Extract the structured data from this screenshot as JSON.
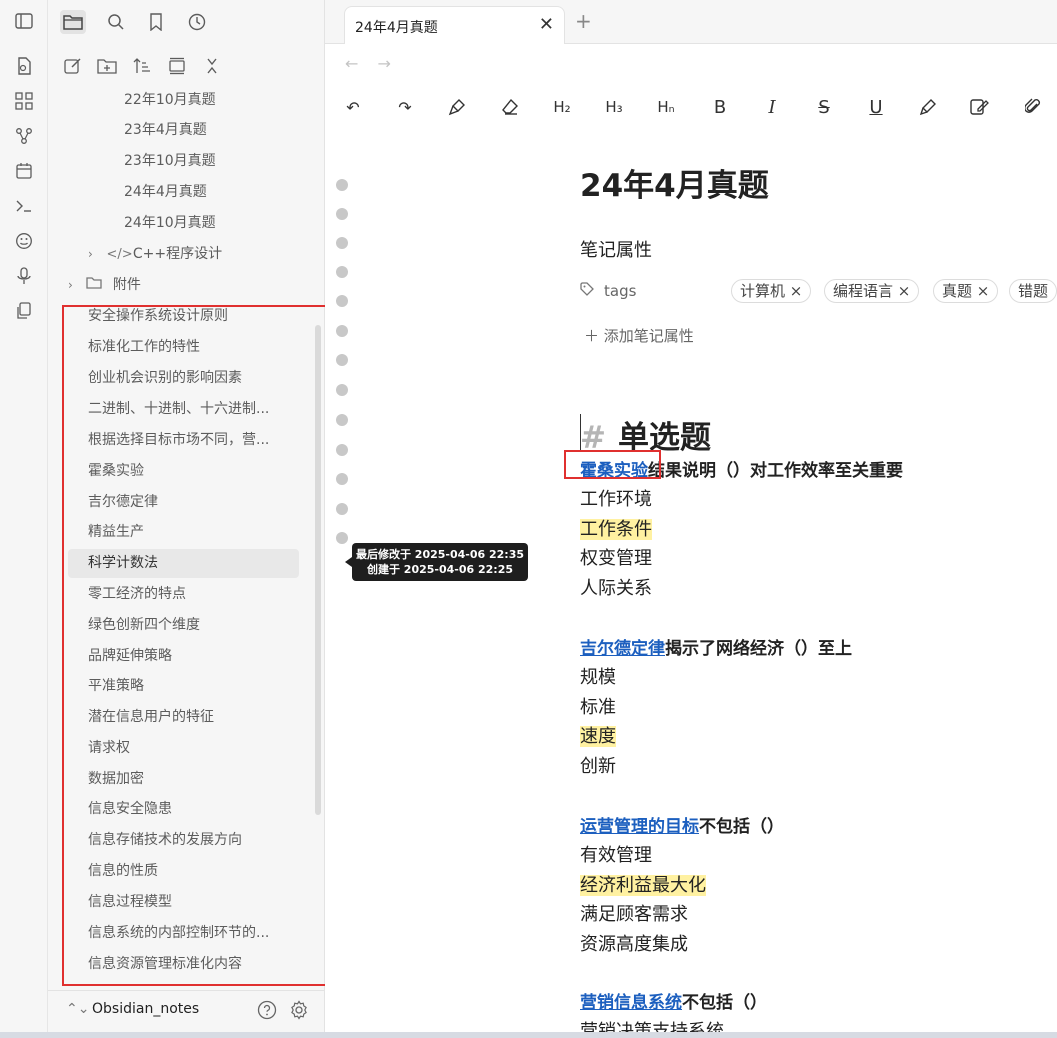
{
  "ribbon": {
    "icons": [
      "sidebar-toggle-icon",
      "new-note-icon",
      "canvas-icon",
      "graph-icon",
      "calendar-icon",
      "terminal-icon",
      "smiley-icon",
      "microphone-icon",
      "copy-icon"
    ]
  },
  "sidebar_top": {
    "icons": [
      "folder-icon",
      "search-icon",
      "bookmark-icon",
      "clock-icon"
    ]
  },
  "sidebar_actions": {
    "icons": [
      "new-note-icon",
      "new-folder-icon",
      "sort-icon",
      "collapse-icon",
      "close-icon"
    ]
  },
  "tree": {
    "items": [
      {
        "label": "22年10月真题"
      },
      {
        "label": "23年4月真题"
      },
      {
        "label": "23年10月真题"
      },
      {
        "label": "24年4月真题"
      },
      {
        "label": "24年10月真题"
      },
      {
        "label": "C++程序设计"
      },
      {
        "label": "附件"
      }
    ]
  },
  "files": {
    "items": [
      {
        "label": "安全操作系统设计原则"
      },
      {
        "label": "标准化工作的特性"
      },
      {
        "label": "创业机会识别的影响因素"
      },
      {
        "label": "二进制、十进制、十六进制..."
      },
      {
        "label": "根据选择目标市场不同，营..."
      },
      {
        "label": "霍桑实验"
      },
      {
        "label": "吉尔德定律"
      },
      {
        "label": "精益生产"
      },
      {
        "label": "科学计数法"
      },
      {
        "label": "零工经济的特点"
      },
      {
        "label": "绿色创新四个维度"
      },
      {
        "label": "品牌延伸策略"
      },
      {
        "label": "平准策略"
      },
      {
        "label": "潜在信息用户的特征"
      },
      {
        "label": "请求权"
      },
      {
        "label": "数据加密"
      },
      {
        "label": "信息安全隐患"
      },
      {
        "label": "信息存储技术的发展方向"
      },
      {
        "label": "信息的性质"
      },
      {
        "label": "信息过程模型"
      },
      {
        "label": "信息系统的内部控制环节的..."
      },
      {
        "label": "信息资源管理标准化内容"
      }
    ],
    "active_index": 8
  },
  "vault": {
    "name": "Obsidian_notes",
    "swap": "⌃⌄"
  },
  "tabs": {
    "active": "24年4月真题",
    "close": "✕",
    "new": "+"
  },
  "nav": {
    "back": "←",
    "forward": "→"
  },
  "toolbar": {
    "undo": "↶",
    "redo": "↷",
    "h2": "H₂",
    "h3": "H₃",
    "hn": "Hₙ",
    "bold": "B",
    "italic": "I",
    "strike": "S",
    "underline": "U"
  },
  "tooltip": {
    "modified": "最后修改于 2025-04-06 22:35",
    "created": "创建于 2025-04-06 22:25"
  },
  "doc": {
    "title": "24年4月真题",
    "props_title": "笔记属性",
    "tags_key": "tags",
    "tags": [
      "计算机 ×",
      "编程语言 ×",
      "真题 ×",
      "错题"
    ],
    "add_property": "＋ 添加笔记属性",
    "heading_hash": "#",
    "heading": "单选题",
    "questions": [
      {
        "link": "霍桑实验",
        "rest": "结果说明（）对工作效率至关重要",
        "options": [
          {
            "text": "工作环境",
            "highlight": false
          },
          {
            "text": "工作条件",
            "highlight": true
          },
          {
            "text": "权变管理",
            "highlight": false
          },
          {
            "text": "人际关系",
            "highlight": false
          }
        ]
      },
      {
        "link": "吉尔德定律",
        "rest": "揭示了网络经济（）至上",
        "options": [
          {
            "text": "规模",
            "highlight": false
          },
          {
            "text": "标准",
            "highlight": false
          },
          {
            "text": "速度",
            "highlight": true
          },
          {
            "text": "创新",
            "highlight": false
          }
        ]
      },
      {
        "link": "运营管理的目标",
        "rest": "不包括（）",
        "options": [
          {
            "text": "有效管理",
            "highlight": false
          },
          {
            "text": "经济利益最大化",
            "highlight": true
          },
          {
            "text": "满足顾客需求",
            "highlight": false
          },
          {
            "text": "资源高度集成",
            "highlight": false
          }
        ]
      },
      {
        "link": "营销信息系统",
        "rest": "不包括（）",
        "options": [
          {
            "text": "营销决策支持系统",
            "highlight": false
          }
        ]
      }
    ]
  },
  "colors": {
    "accent_link": "#1c5fbf",
    "highlight": "#fff1a1",
    "annotation_red": "#e0302f"
  }
}
